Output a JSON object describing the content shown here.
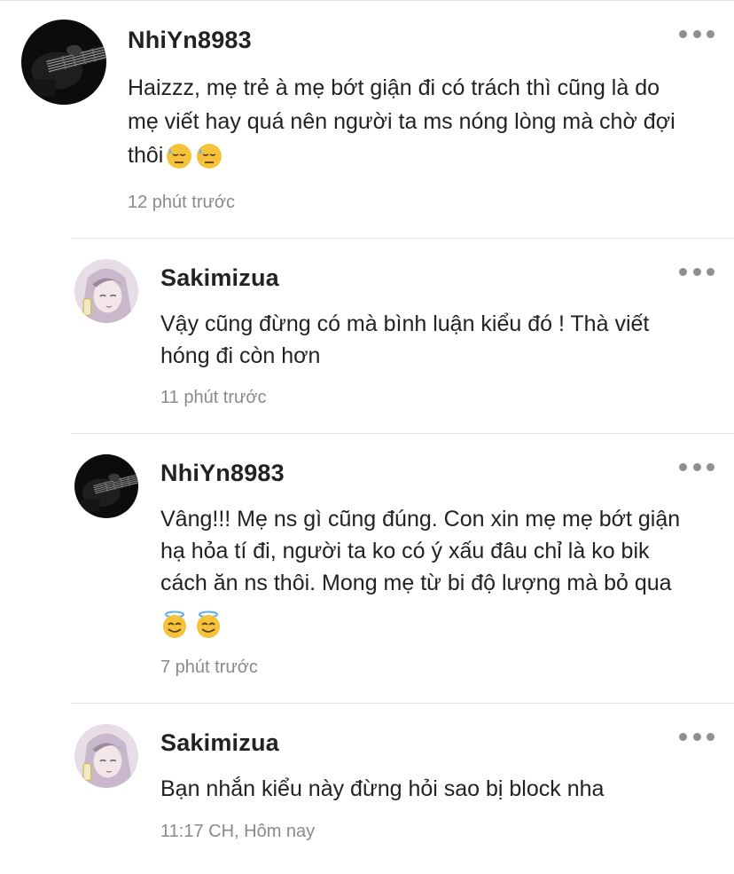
{
  "comments": [
    {
      "username": "NhiYn8983",
      "text": "Haizzz, mẹ trẻ à mẹ bớt giận đi có trách thì cũng là do\nmẹ viết hay quá nên người ta ms nóng lòng mà chờ đợi\nthôi",
      "emojis": [
        "😓",
        "😓"
      ],
      "time": "12 phút trước",
      "avatar": "dark-guitar-avatar"
    },
    {
      "username": "Sakimizua",
      "text": "Vậy cũng đừng có mà bình luận kiểu đó ! Thà viết\nhóng đi còn hơn",
      "emojis": [],
      "time": "11 phút trước",
      "avatar": "anime-girl-avatar"
    },
    {
      "username": "NhiYn8983",
      "text": "Vâng!!! Mẹ ns gì cũng đúng. Con xin mẹ mẹ bớt giận\nhạ hỏa tí đi, người ta ko có ý xấu đâu chỉ là ko bik\ncách ăn ns thôi. Mong mẹ từ bi độ lượng mà bỏ qua",
      "emojis": [
        "😇",
        "😇"
      ],
      "time": "7 phút trước",
      "avatar": "dark-guitar-avatar"
    },
    {
      "username": "Sakimizua",
      "text": "Bạn nhắn kiểu này đừng hỏi sao bị block nha",
      "emojis": [],
      "time": "11:17 CH, Hôm nay",
      "avatar": "anime-girl-avatar"
    }
  ]
}
